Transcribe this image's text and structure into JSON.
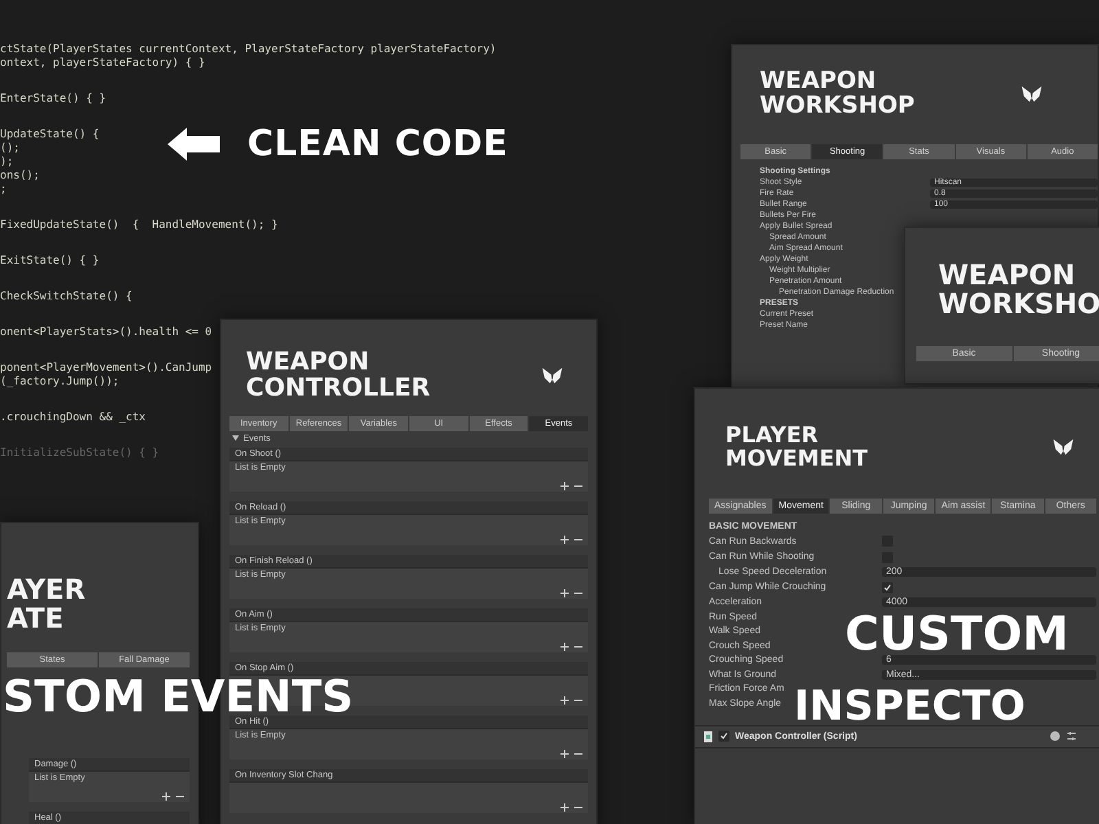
{
  "code": {
    "blocks": [
      {
        "dim": false,
        "lines": [
          "ctState(PlayerStates currentContext, PlayerStateFactory playerStateFactory)",
          "ontext, playerStateFactory) { }"
        ]
      },
      {
        "dim": false,
        "lines": [
          "EnterState() { }"
        ]
      },
      {
        "dim": false,
        "lines": [
          "UpdateState() {",
          "();",
          ");",
          "ons();",
          ";"
        ]
      },
      {
        "dim": false,
        "lines": [
          "FixedUpdateState()  {  HandleMovement(); }"
        ]
      },
      {
        "dim": false,
        "lines": [
          "ExitState() { }"
        ]
      },
      {
        "dim": false,
        "lines": [
          "CheckSwitchState() {"
        ]
      },
      {
        "dim": false,
        "lines": [
          "onent<PlayerStats>().health <= 0"
        ]
      },
      {
        "dim": false,
        "lines": [
          "ponent<PlayerMovement>().CanJump",
          "(_factory.Jump());"
        ]
      },
      {
        "dim": false,
        "lines": [
          ".crouchingDown && _ctx"
        ]
      },
      {
        "dim": true,
        "lines": [
          "InitializeSubState() { }"
        ]
      }
    ]
  },
  "headline": "CLEAN CODE",
  "workshop": {
    "title": [
      "WEAPON",
      "WORKSHOP"
    ],
    "tabs": [
      {
        "label": "Basic",
        "selected": false
      },
      {
        "label": "Shooting",
        "selected": true
      },
      {
        "label": "Stats",
        "selected": false
      },
      {
        "label": "Visuals",
        "selected": false
      },
      {
        "label": "Audio",
        "selected": false
      }
    ],
    "rows": [
      {
        "kind": "section",
        "label": "Shooting Settings"
      },
      {
        "kind": "field",
        "label": "Shoot Style",
        "value": "Hitscan"
      },
      {
        "kind": "field",
        "label": "Fire Rate",
        "value": "0.8"
      },
      {
        "kind": "field",
        "label": "Bullet Range",
        "value": "100"
      },
      {
        "kind": "label",
        "label": "Bullets Per Fire"
      },
      {
        "kind": "label",
        "label": "Apply Bullet Spread",
        "children": [
          {
            "kind": "label",
            "label": "Spread Amount"
          },
          {
            "kind": "label",
            "label": "Aim Spread Amount"
          }
        ]
      },
      {
        "kind": "label",
        "label": "Apply Weight",
        "children": [
          {
            "kind": "label",
            "label": "Weight Multiplier"
          },
          {
            "kind": "label",
            "label": "Penetration Amount",
            "children": [
              {
                "kind": "label",
                "label": "Penetration Damage Reduction"
              }
            ]
          }
        ]
      },
      {
        "kind": "section",
        "label": "PRESETS"
      },
      {
        "kind": "label",
        "label": "Current Preset"
      },
      {
        "kind": "label",
        "label": "Preset Name"
      }
    ]
  },
  "workshop_copy": {
    "title": [
      "WEAPON",
      "WORKSHO"
    ],
    "tabs": [
      {
        "label": "Basic",
        "selected": false
      },
      {
        "label": "Shooting",
        "selected": false
      }
    ]
  },
  "controller": {
    "title": [
      "WEAPON",
      "CONTROLLER"
    ],
    "tabs": [
      {
        "label": "Inventory",
        "selected": false
      },
      {
        "label": "References",
        "selected": false
      },
      {
        "label": "Variables",
        "selected": false
      },
      {
        "label": "UI",
        "selected": false
      },
      {
        "label": "Effects",
        "selected": false
      },
      {
        "label": "Events",
        "selected": true
      }
    ],
    "foldout": "Events",
    "events": [
      {
        "name": "On Shoot ()",
        "list": "List is Empty"
      },
      {
        "name": "On Reload ()",
        "list": "List is Empty"
      },
      {
        "name": "On Finish Reload ()",
        "list": "List is Empty"
      },
      {
        "name": "On Aim ()",
        "list": "List is Empty"
      },
      {
        "name": "On Stop Aim ()"
      },
      {
        "name": "On Hit ()",
        "list": "List is Empty"
      },
      {
        "name": "On Inventory Slot Chang"
      }
    ]
  },
  "player_state": {
    "title": [
      "AYER",
      "ATE"
    ],
    "tabs": [
      {
        "label": "States",
        "selected": false
      },
      {
        "label": "Fall Damage",
        "selected": false
      }
    ],
    "events": [
      {
        "name": "Damage ()",
        "list": "List is Empty"
      },
      {
        "name": "Heal ()"
      }
    ]
  },
  "movement": {
    "title": [
      "PLAYER",
      "MOVEMENT"
    ],
    "tabs": [
      {
        "label": "Assignables",
        "selected": false
      },
      {
        "label": "Movement",
        "selected": true
      },
      {
        "label": "Sliding",
        "selected": false
      },
      {
        "label": "Jumping",
        "selected": false
      },
      {
        "label": "Aim assist",
        "selected": false
      },
      {
        "label": "Stamina",
        "selected": false
      },
      {
        "label": "Others",
        "selected": false
      }
    ],
    "rows": [
      {
        "kind": "section",
        "label": "BASIC MOVEMENT"
      },
      {
        "kind": "check",
        "label": "Can Run Backwards",
        "checked": false
      },
      {
        "kind": "check",
        "label": "Can Run While Shooting",
        "checked": false,
        "children": [
          {
            "kind": "field",
            "label": "Lose Speed Deceleration",
            "value": "200"
          }
        ]
      },
      {
        "kind": "check",
        "label": "Can Jump While Crouching",
        "checked": true
      },
      {
        "kind": "field",
        "label": "Acceleration",
        "value": "4000"
      },
      {
        "kind": "label",
        "label": "Run Speed"
      },
      {
        "kind": "label",
        "label": "Walk Speed"
      },
      {
        "kind": "label",
        "label": "Crouch Speed"
      },
      {
        "kind": "field",
        "label": "Crouching Speed",
        "value": "6"
      },
      {
        "kind": "field",
        "label": "What Is Ground",
        "value": "Mixed..."
      },
      {
        "kind": "label",
        "label": "Friction Force Am"
      },
      {
        "kind": "label",
        "label": "Max Slope Angle"
      }
    ],
    "component": {
      "name": "Weapon Controller (Script)",
      "enabled": true
    }
  },
  "overlays": {
    "custom_events": "STOM EVENTS",
    "custom_inspector": [
      "CUSTOM",
      "INSPECTO"
    ]
  }
}
